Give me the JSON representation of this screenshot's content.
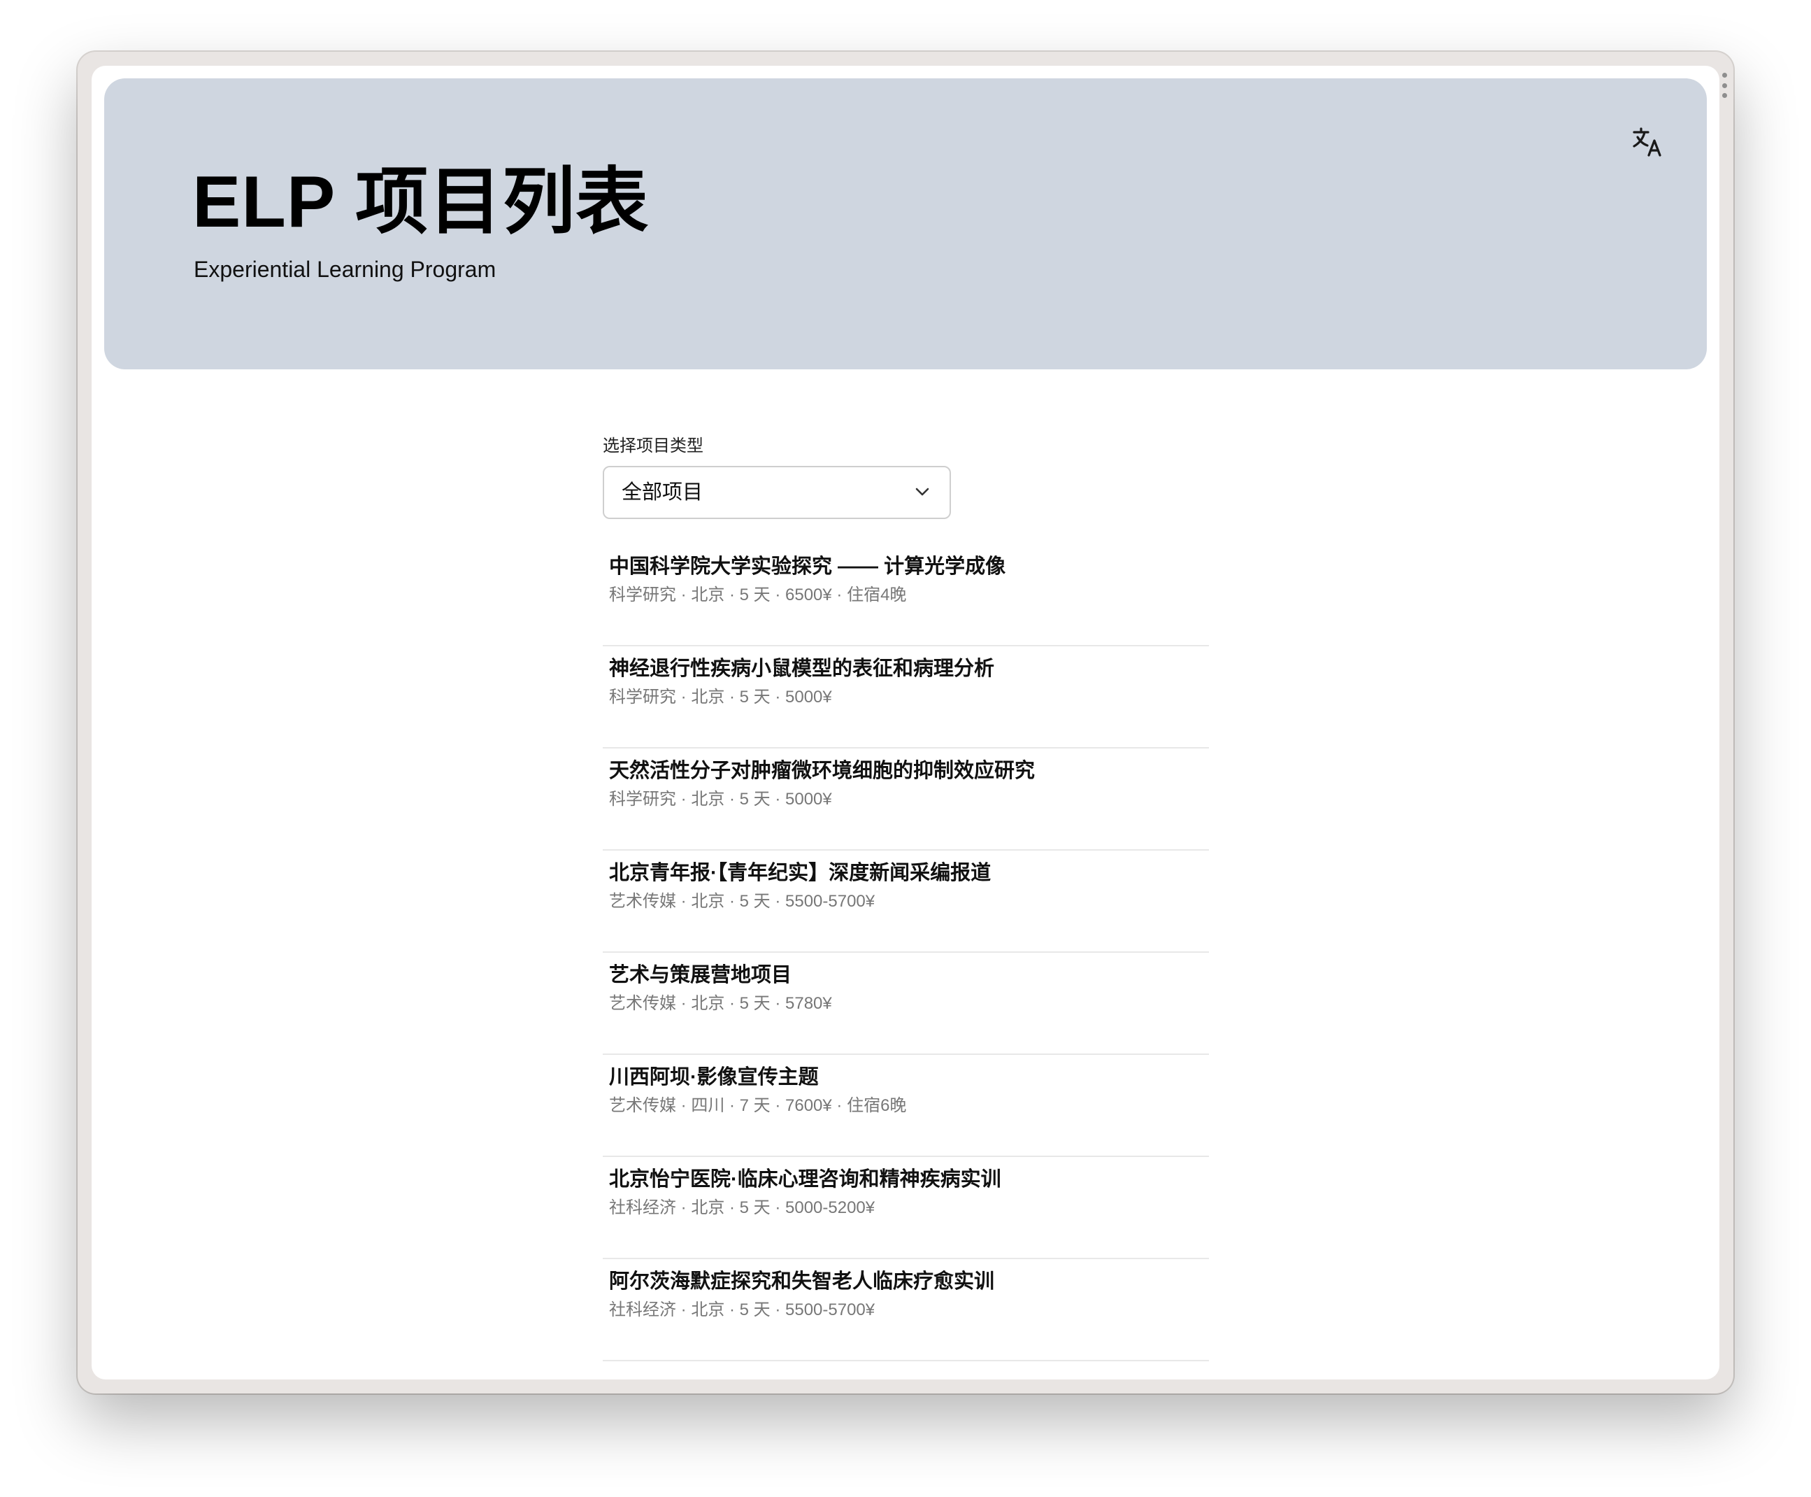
{
  "header": {
    "title": "ELP 项目列表",
    "subtitle": "Experiential Learning Program",
    "language_icon": "translate-icon"
  },
  "filter": {
    "label": "选择项目类型",
    "selected": "全部项目",
    "icon": "chevron-down-icon"
  },
  "projects": [
    {
      "title": "中国科学院大学实验探究 —— 计算光学成像",
      "meta": "科学研究 · 北京 · 5 天 · 6500¥ · 住宿4晚"
    },
    {
      "title": "神经退行性疾病小鼠模型的表征和病理分析",
      "meta": "科学研究 · 北京 · 5 天 · 5000¥"
    },
    {
      "title": "天然活性分子对肿瘤微环境细胞的抑制效应研究",
      "meta": "科学研究 · 北京 · 5 天 · 5000¥"
    },
    {
      "title": "北京青年报·【青年纪实】深度新闻采编报道",
      "meta": "艺术传媒 · 北京 · 5 天 · 5500-5700¥"
    },
    {
      "title": "艺术与策展营地项目",
      "meta": "艺术传媒 · 北京 · 5 天 · 5780¥"
    },
    {
      "title": "川西阿坝·影像宣传主题",
      "meta": "艺术传媒 · 四川 · 7 天 · 7600¥ · 住宿6晚"
    },
    {
      "title": "北京怡宁医院·临床心理咨询和精神疾病实训",
      "meta": "社科经济 · 北京 · 5 天 · 5000-5200¥"
    },
    {
      "title": "阿尔茨海默症探究和失智老人临床疗愈实训",
      "meta": "社科经济 · 北京 · 5 天 · 5500-5700¥"
    }
  ],
  "colors": {
    "hero_background": "#cfd6e0",
    "title_text": "#000000",
    "meta_text": "#777777",
    "divider": "#e8e8e8"
  }
}
